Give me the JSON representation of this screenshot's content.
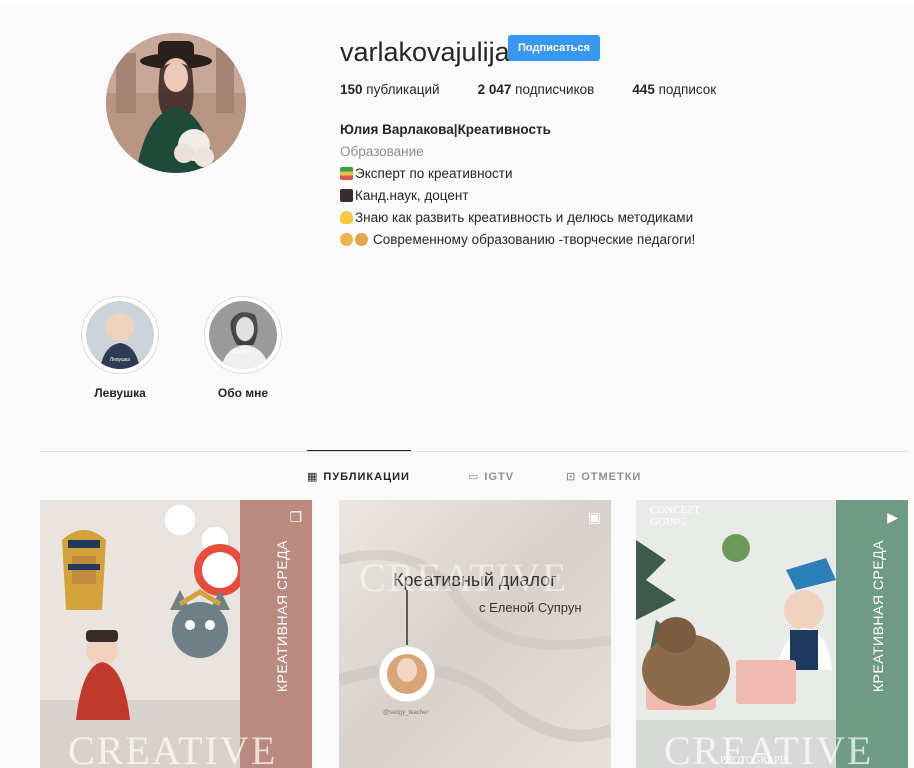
{
  "profile": {
    "username": "varlakovajulija",
    "follow_label": "Подписаться",
    "stats": [
      {
        "count": "150",
        "label": "публикаций"
      },
      {
        "count": "2 047",
        "label": "подписчиков"
      },
      {
        "count": "445",
        "label": "подписок"
      }
    ],
    "full_name": "Юлия Варлакова|Креативность",
    "category": "Образование",
    "bio_lines": [
      "Эксперт по креативности",
      "Канд.наук, доцент",
      "Знаю как развить креативность и делюсь методиками",
      "Современному образованию -творческие педагоги!"
    ]
  },
  "highlights": [
    {
      "label": "Левушка",
      "cover_text": "Левушка"
    },
    {
      "label": "Обо мне",
      "cover_text": "Обо мне"
    }
  ],
  "tabs": [
    {
      "label": "ПУБЛИКАЦИИ",
      "icon": "grid-icon",
      "active": true
    },
    {
      "label": "IGTV",
      "icon": "igtv-icon",
      "active": false
    },
    {
      "label": "ОТМЕТКИ",
      "icon": "tagged-icon",
      "active": false
    }
  ],
  "posts": [
    {
      "vertical_text": "КРЕАТИВНАЯ СРЕДА",
      "watermark": "CREATIVE",
      "badge": "carousel-icon",
      "side_color": "#b98a7d"
    },
    {
      "title": "Креативный диалог",
      "subtitle": "с Еленой Супрун",
      "handle": "@sedgy_teacher",
      "watermark": "CREATIVE",
      "badge": "igtv-icon"
    },
    {
      "vertical_text": "КРЕАТИВНАЯ СРЕДА",
      "watermark": "CREATIVE",
      "caption": "PHOTOGRAPH",
      "header_text": "CONCEPT GGING",
      "badge": "play-icon",
      "side_color": "#6f9b86"
    }
  ],
  "colors": {
    "accent": "#3897f0",
    "muted": "#8e8e8e",
    "text": "#262626"
  }
}
